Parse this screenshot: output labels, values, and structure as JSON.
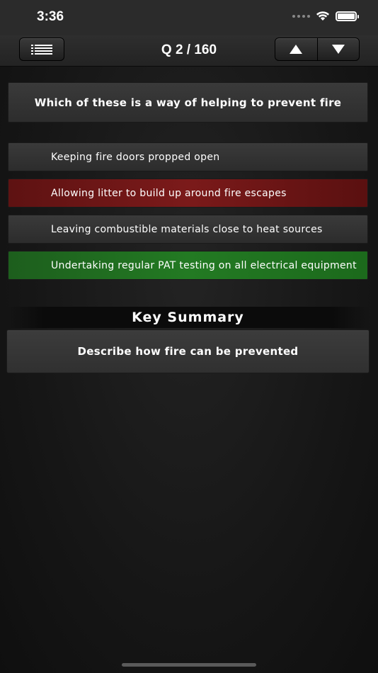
{
  "status": {
    "time": "3:36"
  },
  "nav": {
    "title": "Q 2 / 160"
  },
  "question": {
    "text": "Which of these is a way of helping to prevent fire"
  },
  "answers": [
    {
      "text": "Keeping fire doors propped open",
      "state": "default"
    },
    {
      "text": "Allowing litter to build up around fire escapes",
      "state": "wrong"
    },
    {
      "text": "Leaving combustible materials close to heat sources",
      "state": "default"
    },
    {
      "text": "Undertaking regular PAT testing on all electrical equipment",
      "state": "correct"
    }
  ],
  "summary": {
    "heading": "Key Summary",
    "text": "Describe how fire can be prevented"
  },
  "colors": {
    "wrong": "#7b1a1a",
    "correct": "#237a23"
  },
  "icons": {
    "menu": "list-icon",
    "up": "arrow-up-icon",
    "down": "arrow-down-icon"
  }
}
